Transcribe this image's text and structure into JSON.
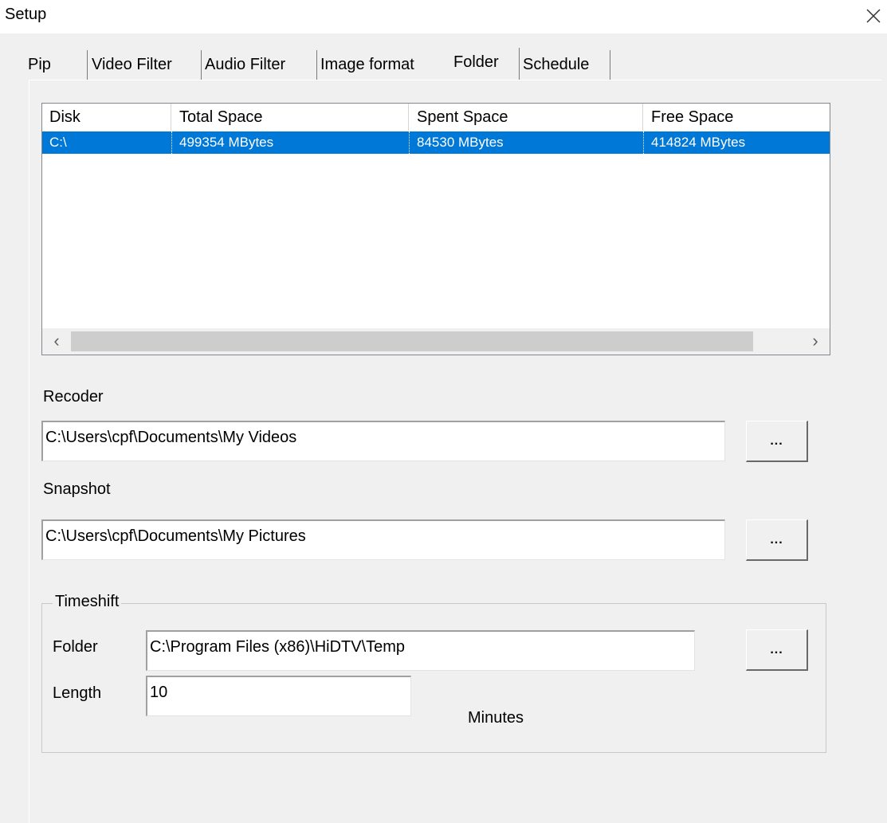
{
  "window": {
    "title": "Setup",
    "close_icon": "close-icon"
  },
  "tabs": [
    {
      "label": "Pip",
      "active": false
    },
    {
      "label": "Video Filter",
      "active": false
    },
    {
      "label": "Audio Filter",
      "active": false
    },
    {
      "label": "Image format",
      "active": false
    },
    {
      "label": "Folder",
      "active": true
    },
    {
      "label": "Schedule",
      "active": false
    }
  ],
  "disk_list": {
    "columns": [
      "Disk",
      "Total Space",
      "Spent Space",
      "Free Space"
    ],
    "rows": [
      {
        "disk": "C:\\",
        "total": "499354  MBytes",
        "spent": "84530  MBytes",
        "free": "414824  MBytes",
        "selected": true
      }
    ],
    "scroll_left": "‹",
    "scroll_right": "›"
  },
  "recorder": {
    "label": "Recoder",
    "path": "C:\\Users\\cpf\\Documents\\My Videos",
    "browse_label": "..."
  },
  "snapshot": {
    "label": "Snapshot",
    "path": "C:\\Users\\cpf\\Documents\\My Pictures",
    "browse_label": "..."
  },
  "timeshift": {
    "group_label": "Timeshift",
    "folder_label": "Folder",
    "folder_path": "C:\\Program Files (x86)\\HiDTV\\Temp",
    "browse_label": "...",
    "length_label": "Length",
    "length_value": "10",
    "length_unit": "Minutes"
  },
  "colors": {
    "selection": "#0078d7",
    "window_bg": "#f0f0f0",
    "field_bg": "#ffffff"
  }
}
